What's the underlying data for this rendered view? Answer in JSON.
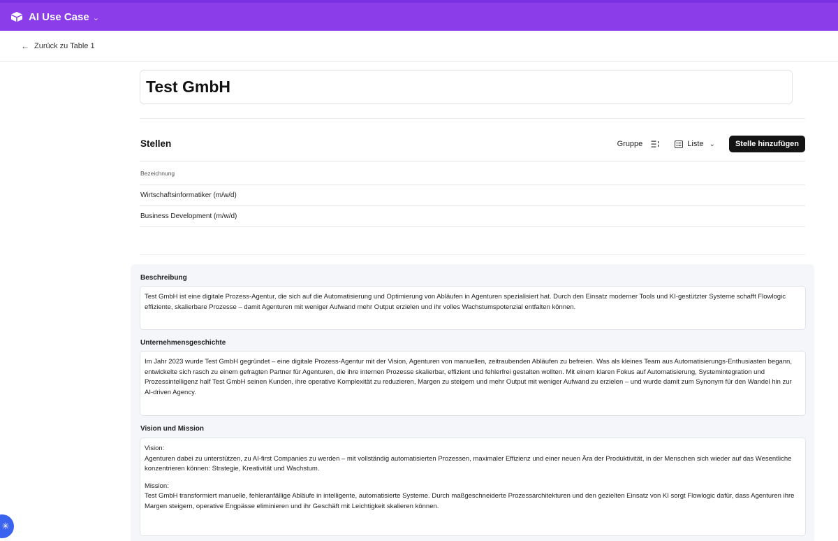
{
  "app": {
    "title": "AI Use Case",
    "brand_color": "#8b3dea",
    "icon": "box-icon"
  },
  "nav": {
    "back_label": "Zurück zu Table 1"
  },
  "record": {
    "title": "Test GmbH"
  },
  "stellen": {
    "title": "Stellen",
    "group_label": "Gruppe",
    "view_label": "Liste",
    "add_button": "Stelle hinzufügen",
    "column_header": "Bezeichnung",
    "rows": [
      {
        "label": "Wirtschaftsinformatiker (m/w/d)"
      },
      {
        "label": "Business Development (m/w/d)"
      }
    ]
  },
  "sections": {
    "beschreibung": {
      "label": "Beschreibung",
      "text": "Test GmbH ist eine digitale Prozess-Agentur, die sich auf die Automatisierung und Optimierung von Abläufen in Agenturen spezialisiert hat. Durch den Einsatz moderner Tools und KI-gestützter Systeme schafft Flowlogic effiziente, skalierbare Prozesse – damit Agenturen mit weniger Aufwand mehr Output erzielen und ihr volles Wachstumspotenzial entfalten können."
    },
    "geschichte": {
      "label": "Unternehmensgeschichte",
      "text": "Im Jahr 2023 wurde Test GmbH gegründet – eine digitale Prozess-Agentur mit der Vision, Agenturen von manuellen, zeitraubenden Abläufen zu befreien. Was als kleines Team aus Automatisierungs-Enthusiasten begann, entwickelte sich rasch zu einem gefragten Partner für Agenturen, die ihre internen Prozesse skalierbar, effizient und fehlerfrei gestalten wollten. Mit einem klaren Fokus auf Automatisierung, Systemintegration und Prozessintelligenz half Test GmbH seinen Kunden, ihre operative Komplexität zu reduzieren, Margen zu steigern und mehr Output mit weniger Aufwand zu erzielen – und wurde damit zum Synonym für den Wandel hin zur AI-driven Agency."
    },
    "vision": {
      "label": "Vision und Mission",
      "vision_heading": "Vision:",
      "vision_text": "Agenturen dabei zu unterstützen, zu AI-first Companies zu werden – mit vollständig automatisierten Prozessen, maximaler Effizienz und einer neuen Ära der Produktivität, in der Menschen sich wieder auf das Wesentliche konzentrieren können: Strategie, Kreativität und Wachstum.",
      "mission_heading": "Mission:",
      "mission_text": "Test GmbH transformiert manuelle, fehleranfällige Abläufe in intelligente, automatisierte Systeme. Durch maßgeschneiderte Prozessarchitekturen und den gezielten Einsatz von KI sorgt Flowlogic dafür, dass Agenturen ihre Margen steigern, operative Engpässe eliminieren und ihr Geschäft mit Leichtigkeit skalieren können."
    }
  }
}
